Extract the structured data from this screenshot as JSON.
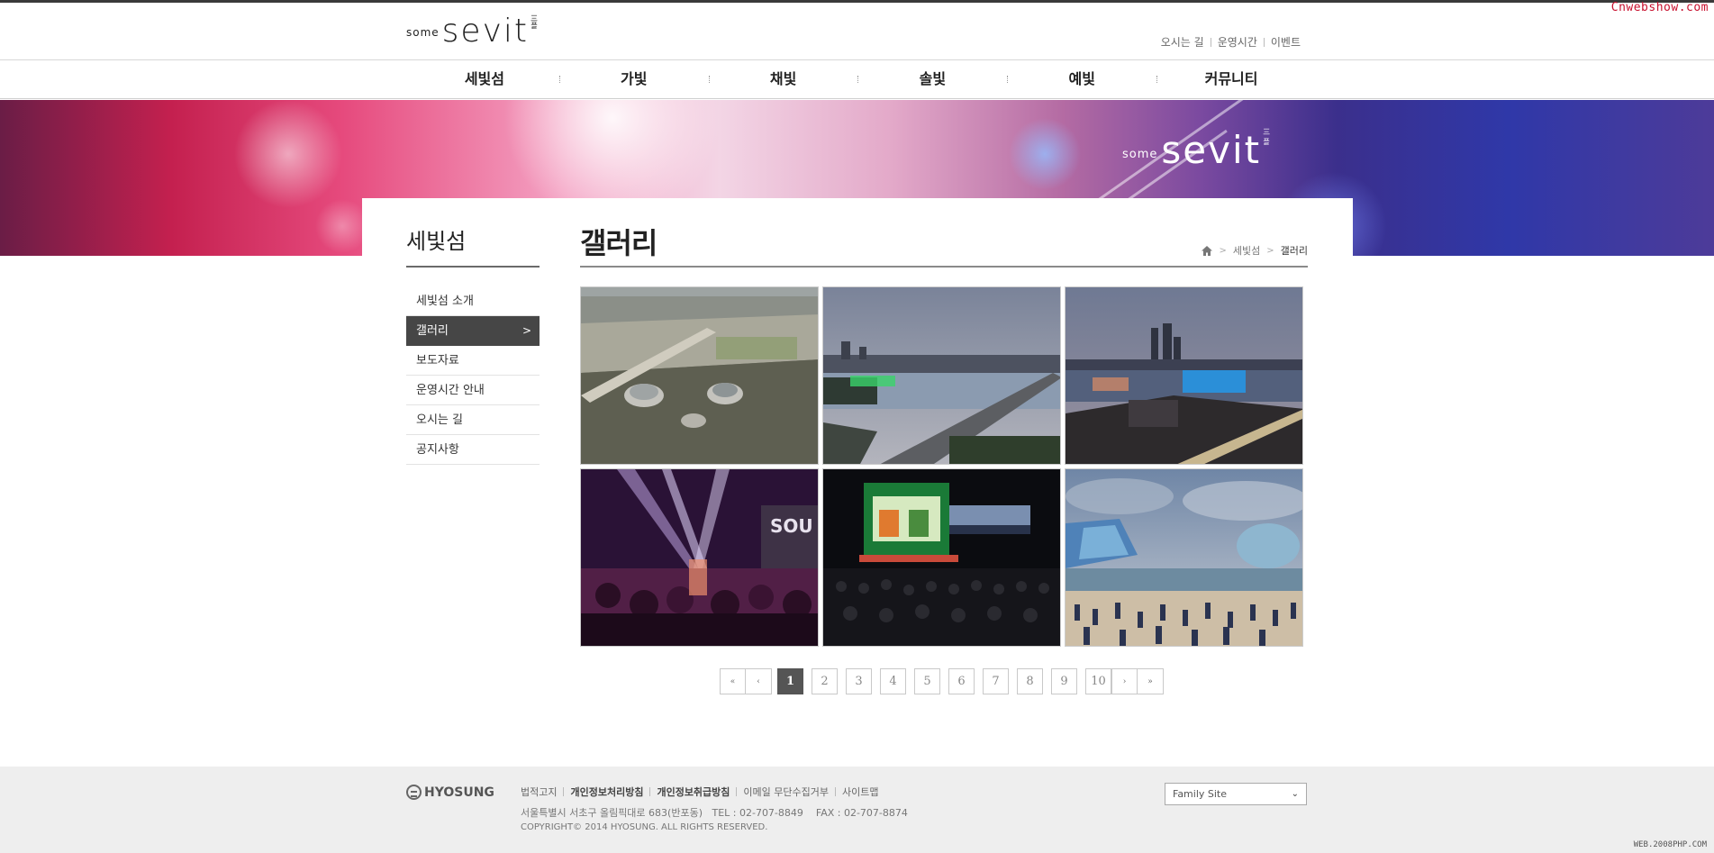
{
  "watermark": {
    "top": "Cnwebshow.com",
    "bottom": "WEB.2008PHP.COM"
  },
  "header": {
    "logo": {
      "some": "some",
      "sevit": "sevit",
      "mark": "三\n플"
    },
    "util_links": [
      "오시는 길",
      "운영시간",
      "이벤트"
    ]
  },
  "gnb": [
    "세빛섬",
    "가빛",
    "채빛",
    "솔빛",
    "예빛",
    "커뮤니티"
  ],
  "banner": {
    "some": "some",
    "sevit": "sevit",
    "mark": "三\n플"
  },
  "lnb": {
    "title": "세빛섬",
    "items": [
      {
        "label": "세빛섬 소개",
        "active": false
      },
      {
        "label": "갤러리",
        "active": true
      },
      {
        "label": "보도자료",
        "active": false
      },
      {
        "label": "운영시간 안내",
        "active": false
      },
      {
        "label": "오시는 길",
        "active": false
      },
      {
        "label": "공지사항",
        "active": false
      }
    ],
    "active_arrow": ">"
  },
  "main": {
    "title": "갤러리",
    "breadcrumb": [
      "세빛섬",
      "갤러리"
    ]
  },
  "gallery": [
    {
      "scene": "aerial-islands"
    },
    {
      "scene": "bridge-dusk"
    },
    {
      "scene": "night-skyline"
    },
    {
      "scene": "concert-lights"
    },
    {
      "scene": "outdoor-stage"
    },
    {
      "scene": "plaza-crowd"
    }
  ],
  "pagination": {
    "first": "«",
    "prev": "‹",
    "pages": [
      "1",
      "2",
      "3",
      "4",
      "5",
      "6",
      "7",
      "8",
      "9",
      "10"
    ],
    "current": "1",
    "next": "›",
    "last": "»"
  },
  "footer": {
    "logo": "HYOSUNG",
    "links": [
      {
        "label": "법적고지",
        "bold": false
      },
      {
        "label": "개인정보처리방침",
        "bold": true
      },
      {
        "label": "개인정보취급방침",
        "bold": true
      },
      {
        "label": "이메일 무단수집거부",
        "bold": false
      },
      {
        "label": "사이트맵",
        "bold": false
      }
    ],
    "address": "서울특별시 서초구 올림픽대로 683(반포동)   TEL : 02-707-8849    FAX : 02-707-8874",
    "copyright": "COPYRIGHT© 2014 HYOSUNG. ALL RIGHTS RESERVED.",
    "family_site": "Family Site"
  }
}
